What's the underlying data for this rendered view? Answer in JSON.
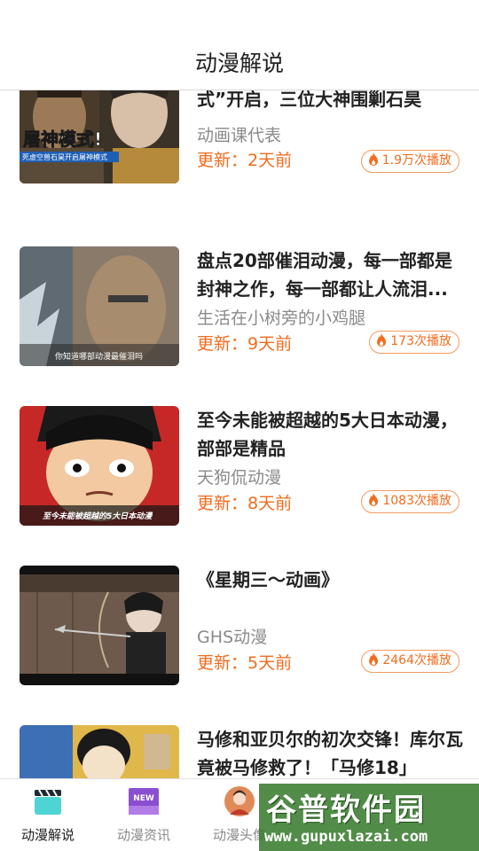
{
  "header": {
    "title": "动漫解说"
  },
  "items": [
    {
      "title": "石昊一脚踢死虚空兽，“屠神模式”开启，三位大神围剿石昊",
      "author": "动画课代表",
      "updated": "更新：2天前",
      "plays": "1.9万次播放",
      "thumb_caption": "屠神模式!",
      "thumb_sub": "死虚空兽石昊开启屠神模式"
    },
    {
      "title": "盘点20部催泪动漫，每一部都是封神之作，每一部都让人流泪...",
      "author": "生活在小树旁的小鸡腿",
      "updated": "更新：9天前",
      "plays": "173次播放",
      "thumb_sub": "你知道哪部动漫最催泪吗"
    },
    {
      "title": "至今未能被超越的5大日本动漫，部部是精品",
      "author": "天狗侃动漫",
      "updated": "更新：8天前",
      "plays": "1083次播放",
      "thumb_sub": "至今未能被超越的5大日本动漫"
    },
    {
      "title": "《星期三～动画》",
      "author": "GHS动漫",
      "updated": "更新：5天前",
      "plays": "2464次播放"
    },
    {
      "title": "马修和亚贝尔的初次交锋！库尔瓦竟被马修救了！「马修18」",
      "author": "",
      "updated": "",
      "plays": ""
    }
  ],
  "tabbar": {
    "tabs": [
      {
        "label": "动漫解说",
        "icon": "clapperboard-icon",
        "active": true
      },
      {
        "label": "动漫资讯",
        "icon": "new-badge-icon",
        "badge": "NEW"
      },
      {
        "label": "动漫头像",
        "icon": "avatar-icon"
      },
      {
        "label": "",
        "icon": ""
      },
      {
        "label": "",
        "icon": ""
      }
    ]
  },
  "watermark": {
    "title": "谷普软件园",
    "url": "www.gupuxlazai.com"
  },
  "colors": {
    "accent": "#f26b1d",
    "title_text": "#222222",
    "muted_text": "#8a8a8a",
    "tab_icon_teal": "#4fd4d4",
    "tab_icon_purple": "#8a4fd0"
  }
}
